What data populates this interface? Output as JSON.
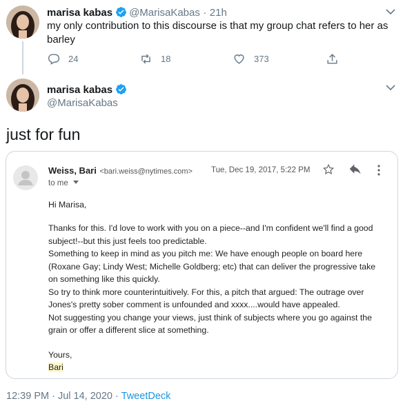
{
  "reply_tweet": {
    "name": "marisa kabas",
    "handle": "@MarisaKabas",
    "separator": "·",
    "time": "21h",
    "text": "my only contribution to this discourse is that my group chat refers to her as barley",
    "reply_count": "24",
    "retweet_count": "18",
    "like_count": "373"
  },
  "main_tweet": {
    "name": "marisa kabas",
    "handle": "@MarisaKabas",
    "text": "just for fun",
    "footer_time": "12:39 PM",
    "footer_sep1": "·",
    "footer_date": "Jul 14, 2020",
    "footer_sep2": "·",
    "footer_client": "TweetDeck"
  },
  "email": {
    "sender_name": "Weiss, Bari",
    "sender_email": "<bari.weiss@nytimes.com>",
    "date": "Tue, Dec 19, 2017, 5:22 PM",
    "to": "to me",
    "greeting": "Hi Marisa,",
    "lines": [
      "Thanks for this. I'd love to work with you on a piece--and I'm confident we'll find a good",
      "subject!--but this just feels too predictable.",
      "Something to keep in mind as you pitch me: We have enough people on board here",
      "(Roxane Gay; Lindy West; Michelle Goldberg; etc) that can deliver the progressive take",
      "on something like this quickly.",
      "So try to think more counterintuitively. For this, a pitch that argued: The outrage over",
      "Jones's pretty sober comment is unfounded and xxxx....would have appealed.",
      "Not suggesting you change your views, just think of subjects where you go against the",
      "grain or offer a different slice at something."
    ],
    "closing": "Yours,",
    "signature": "Bari"
  },
  "colors": {
    "verified": "#1da1f2",
    "link": "#1b95e0",
    "muted": "#657786"
  }
}
